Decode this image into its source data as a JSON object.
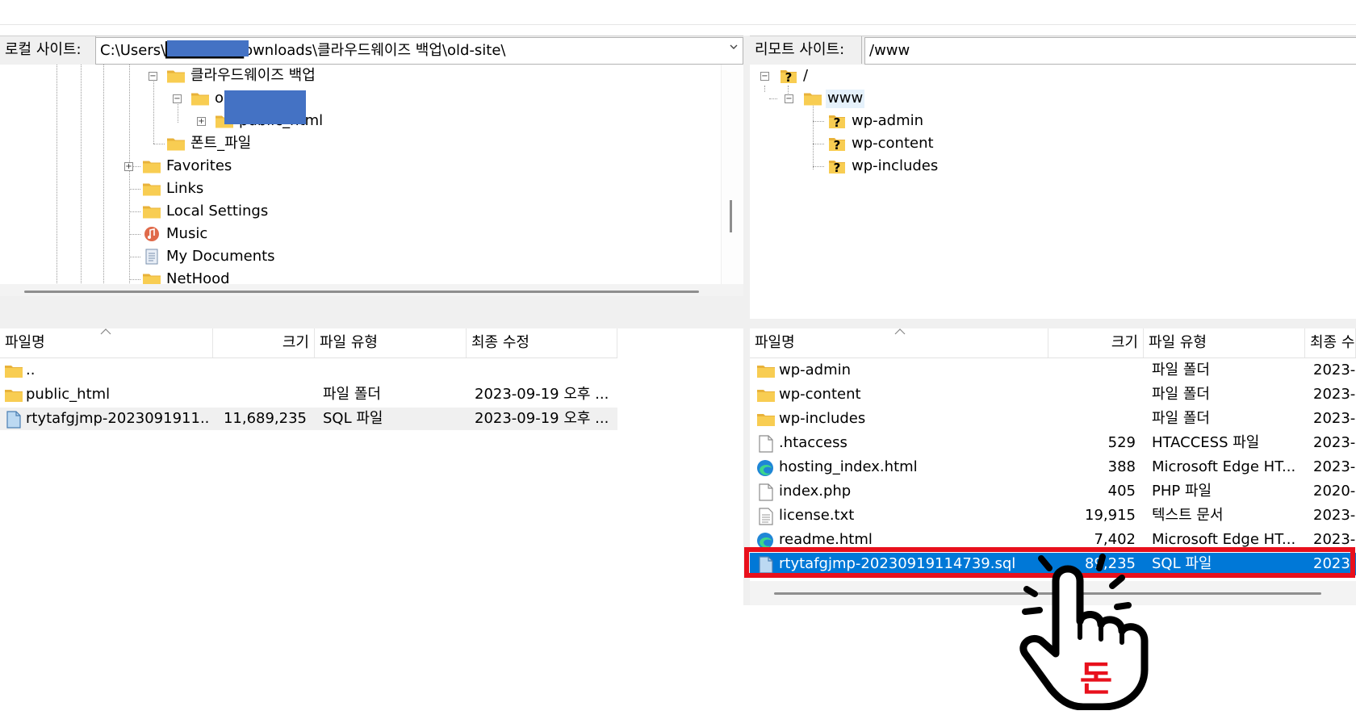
{
  "local": {
    "label": "로컬 사이트:",
    "path": "C:\\Users\\███████ownloads\\클라우드웨이즈 백업\\old-site\\",
    "tree": [
      {
        "label": "클라우드웨이즈 백업"
      },
      {
        "label": "o"
      },
      {
        "label": "public_html"
      },
      {
        "label": "폰트_파일"
      },
      {
        "label": "Favorites"
      },
      {
        "label": "Links"
      },
      {
        "label": "Local Settings"
      },
      {
        "label": "Music"
      },
      {
        "label": "My Documents"
      },
      {
        "label": "NetHood"
      }
    ],
    "columns": [
      "파일명",
      "크기",
      "파일 유형",
      "최종 수정"
    ],
    "files": [
      {
        "name": "..",
        "size": "",
        "type": "",
        "modified": ""
      },
      {
        "name": "public_html",
        "size": "",
        "type": "파일 폴더",
        "modified": "2023-09-19 오후 ..."
      },
      {
        "name": "rtytafgjmp-2023091911...",
        "size": "11,689,235",
        "type": "SQL 파일",
        "modified": "2023-09-19 오후 ..."
      }
    ]
  },
  "remote": {
    "label": "리모트 사이트:",
    "path": "/www",
    "tree": [
      {
        "label": "/"
      },
      {
        "label": "www"
      },
      {
        "label": "wp-admin"
      },
      {
        "label": "wp-content"
      },
      {
        "label": "wp-includes"
      }
    ],
    "columns": [
      "파일명",
      "크기",
      "파일 유형",
      "최종 수"
    ],
    "files": [
      {
        "name": "wp-admin",
        "size": "",
        "type": "파일 폴더",
        "modified": "2023-"
      },
      {
        "name": "wp-content",
        "size": "",
        "type": "파일 폴더",
        "modified": "2023-"
      },
      {
        "name": "wp-includes",
        "size": "",
        "type": "파일 폴더",
        "modified": "2023-"
      },
      {
        "name": ".htaccess",
        "size": "529",
        "type": "HTACCESS 파일",
        "modified": "2023-"
      },
      {
        "name": "hosting_index.html",
        "size": "388",
        "type": "Microsoft Edge HT...",
        "modified": "2023-"
      },
      {
        "name": "index.php",
        "size": "405",
        "type": "PHP 파일",
        "modified": "2020-"
      },
      {
        "name": "license.txt",
        "size": "19,915",
        "type": "텍스트 문서",
        "modified": "2023-"
      },
      {
        "name": "readme.html",
        "size": "7,402",
        "type": "Microsoft Edge HT...",
        "modified": "2023-"
      },
      {
        "name": "rtytafgjmp-20230919114739.sql",
        "size": "89,235",
        "type": "SQL 파일",
        "modified": "2023"
      }
    ]
  },
  "overlay": {
    "badge_text": "돈"
  },
  "colors": {
    "selection": "#0078d7",
    "highlight_box": "#e8101c",
    "redaction": "#4472c4",
    "folder": "#f8c94a"
  }
}
